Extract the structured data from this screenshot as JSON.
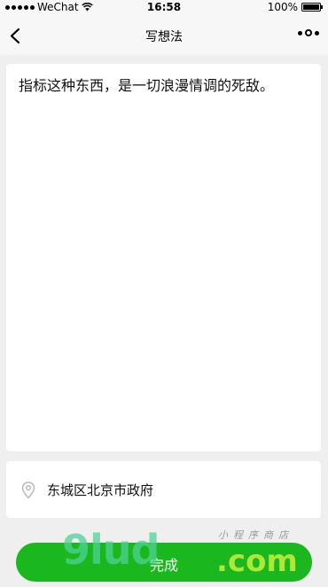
{
  "status_bar": {
    "carrier": "WeChat",
    "time": "16:58",
    "battery": "100%"
  },
  "nav": {
    "title": "写想法"
  },
  "note": {
    "text": "指标这种东西，是一切浪漫情调的死敌。"
  },
  "location": {
    "icon": "location-pin-icon",
    "text": "东城区北京市政府"
  },
  "done_button": {
    "label": "完成"
  },
  "watermark": {
    "logo": "9lud",
    "domain": ".com",
    "tagline": "小程序商店"
  },
  "colors": {
    "accent": "#1ab71e",
    "background": "#efefef",
    "bar": "#f7f7f7"
  }
}
